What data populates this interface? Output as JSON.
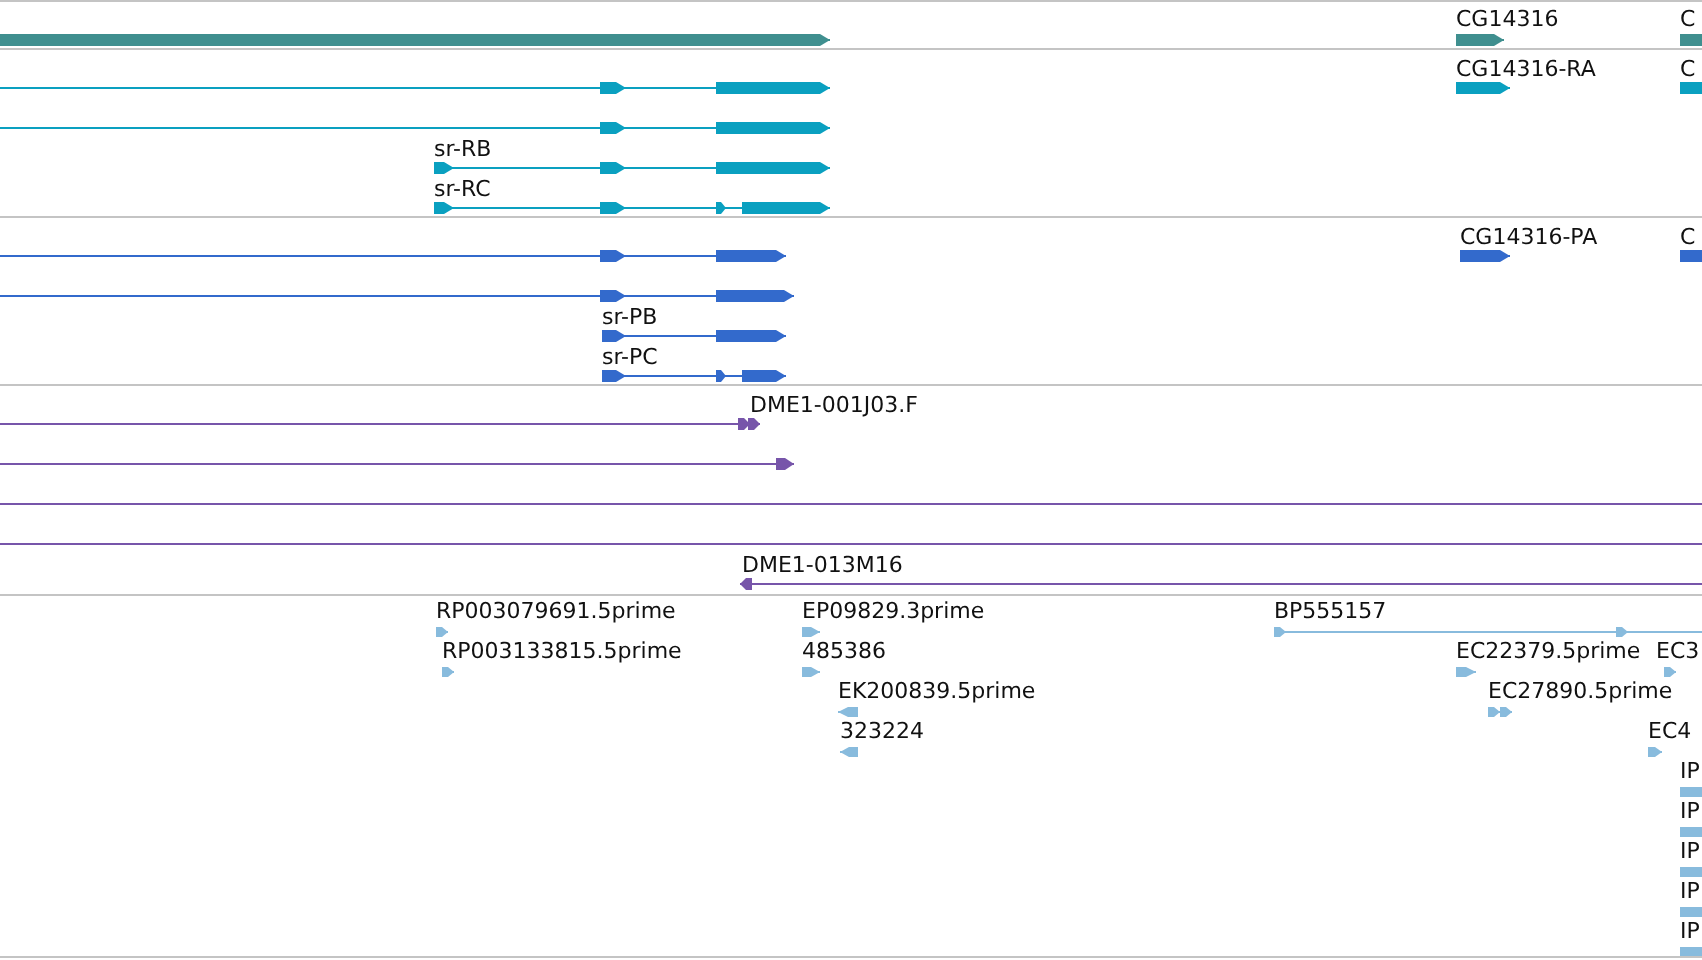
{
  "tracks": [
    {
      "color": "#3f8f8f",
      "features": [
        {
          "reverse": false
        },
        {
          "reverse": false,
          "label": "CG14316"
        },
        {
          "reverse": false,
          "label": "C"
        }
      ]
    },
    {
      "color": "#0aa0c0",
      "features": [
        {
          "reverse": false
        },
        {
          "reverse": false
        },
        {
          "reverse": false,
          "label": "sr-RB"
        },
        {
          "reverse": false,
          "label": "sr-RC"
        },
        {
          "reverse": false,
          "label": "CG14316-RA"
        },
        {
          "reverse": false,
          "label": "C"
        }
      ]
    },
    {
      "color": "#336acc",
      "features": [
        {
          "reverse": false
        },
        {
          "reverse": false
        },
        {
          "reverse": false,
          "label": "sr-PB"
        },
        {
          "reverse": false,
          "label": "sr-PC"
        },
        {
          "reverse": false,
          "label": "CG14316-PA"
        },
        {
          "reverse": false,
          "label": "C"
        }
      ]
    },
    {
      "color": "#7755aa",
      "features": [
        {
          "reverse": false,
          "label": "DME1-001J03.F"
        },
        {
          "reverse": false
        },
        {
          "kind": "line"
        },
        {
          "kind": "line"
        },
        {
          "reverse": true,
          "label": "DME1-013M16"
        }
      ]
    },
    {
      "color": "#88bbdd",
      "features": [
        {
          "reverse": false,
          "label": "RP003079691.5prime"
        },
        {
          "reverse": false,
          "label": "RP003133815.5prime"
        },
        {
          "reverse": false,
          "label": "EP09829.3prime"
        },
        {
          "reverse": false,
          "label": "485386"
        },
        {
          "reverse": true,
          "label": "EK200839.5prime"
        },
        {
          "reverse": true,
          "label": "323224"
        },
        {
          "reverse": false,
          "label": "BP555157"
        },
        {
          "reverse": false,
          "label": "EC22379.5prime"
        },
        {
          "reverse": false,
          "label": "EC3"
        },
        {
          "reverse": false,
          "label": "EC27890.5prime"
        },
        {
          "reverse": false,
          "label": "EC4"
        },
        {
          "reverse": false,
          "label": "IP"
        },
        {
          "reverse": false,
          "label": "IP"
        },
        {
          "reverse": false,
          "label": "IP"
        },
        {
          "reverse": false,
          "label": "IP"
        },
        {
          "reverse": false,
          "label": "IP"
        }
      ]
    }
  ]
}
